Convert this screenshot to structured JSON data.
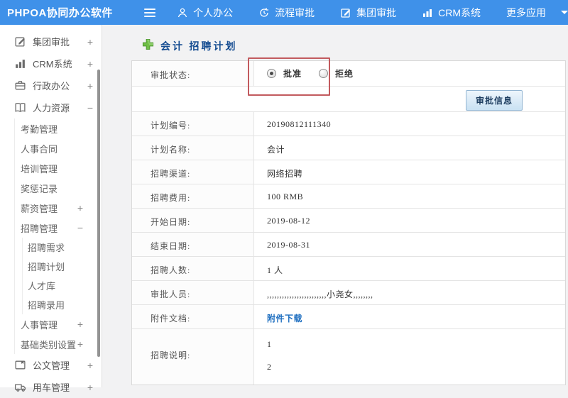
{
  "colors": {
    "topbar_bg": "#3f91e9",
    "title_text": "#174e92",
    "link": "#1f6fc0",
    "annotation_red": "#c25a5e",
    "button_border": "#93b5d2",
    "plus_green": "#6fbe45"
  },
  "topbar": {
    "brand": "PHPOA协同办公软件",
    "items": [
      {
        "label": "个人办公",
        "icon": "user-icon"
      },
      {
        "label": "流程审批",
        "icon": "process-icon"
      },
      {
        "label": "集团审批",
        "icon": "edit-icon"
      },
      {
        "label": "CRM系统",
        "icon": "bar-chart-icon"
      },
      {
        "label": "更多应用",
        "icon": "caret-down-icon"
      }
    ]
  },
  "sidebar": {
    "items": [
      {
        "label": "集团审批",
        "icon": "edit-icon",
        "expander": "+"
      },
      {
        "label": "CRM系统",
        "icon": "bar-chart-icon",
        "expander": "+"
      },
      {
        "label": "行政办公",
        "icon": "briefcase-icon",
        "expander": "+"
      },
      {
        "label": "人力资源",
        "icon": "book-icon",
        "expander": "−",
        "children": [
          {
            "label": "考勤管理",
            "expander": ""
          },
          {
            "label": "人事合同",
            "expander": ""
          },
          {
            "label": "培训管理",
            "expander": ""
          },
          {
            "label": "奖惩记录",
            "expander": ""
          },
          {
            "label": "薪资管理",
            "expander": "+"
          },
          {
            "label": "招聘管理",
            "expander": "−",
            "children": [
              {
                "label": "招聘需求"
              },
              {
                "label": "招聘计划"
              },
              {
                "label": "人才库"
              },
              {
                "label": "招聘录用"
              }
            ]
          },
          {
            "label": "人事管理",
            "expander": "+"
          },
          {
            "label": "基础类别设置",
            "expander": "+"
          }
        ]
      },
      {
        "label": "公文管理",
        "icon": "document-icon",
        "expander": "+"
      },
      {
        "label": "用车管理",
        "icon": "truck-icon",
        "expander": "+"
      }
    ]
  },
  "main": {
    "title": "会计 招聘计划",
    "approval_row": {
      "label": "审批状态:",
      "options": [
        {
          "label": "批准",
          "selected": true
        },
        {
          "label": "拒绝",
          "selected": false
        }
      ]
    },
    "approve_info_button": "审批信息",
    "fields": [
      {
        "label": "计划编号:",
        "value": "20190812111340"
      },
      {
        "label": "计划名称:",
        "value": "会计"
      },
      {
        "label": "招聘渠道:",
        "value": "网络招聘"
      },
      {
        "label": "招聘费用:",
        "value": "100 RMB"
      },
      {
        "label": "开始日期:",
        "value": "2019-08-12"
      },
      {
        "label": "结束日期:",
        "value": "2019-08-31"
      },
      {
        "label": "招聘人数:",
        "value": "1 人"
      },
      {
        "label": "审批人员:",
        "value": ",,,,,,,,,,,,,,,,,,,,,,,,小尧女,,,,,,,,"
      },
      {
        "label": "附件文档:",
        "value": "附件下载"
      },
      {
        "label": "招聘说明:",
        "lines": [
          "1",
          "2"
        ]
      }
    ]
  }
}
